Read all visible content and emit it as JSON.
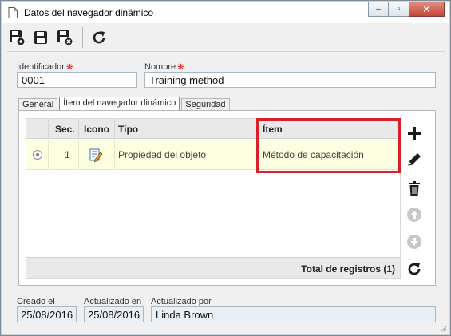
{
  "window": {
    "title": "Datos del navegador dinámico",
    "min_label": "–",
    "max_label": "▫",
    "close_label": "✕"
  },
  "toolbar": {
    "icons": [
      "save-new-icon",
      "save-icon",
      "save-close-icon",
      "refresh-icon"
    ]
  },
  "form": {
    "identifier_label": "Identificador",
    "identifier_value": "0001",
    "name_label": "Nombre",
    "name_value": "Training method",
    "required_mark": "❋"
  },
  "tabs": [
    {
      "label": "General",
      "active": false
    },
    {
      "label": "Ítem del navegador dinámico",
      "active": true
    },
    {
      "label": "Seguridad",
      "active": false
    }
  ],
  "grid": {
    "columns": {
      "seq": "Sec.",
      "icon": "Icono",
      "type": "Tipo",
      "item": "Ítem"
    },
    "rows": [
      {
        "selected": true,
        "seq": "1",
        "icon": "edit-document-icon",
        "type": "Propiedad del objeto",
        "item": "Método de capacitación"
      }
    ],
    "footer": "Total de registros (1)"
  },
  "side_actions": {
    "icons": [
      "add-icon",
      "edit-icon",
      "delete-icon",
      "move-up-icon",
      "move-down-icon",
      "refresh-icon"
    ]
  },
  "audit": {
    "created_label": "Creado el",
    "created_value": "25/08/2016",
    "updated_label": "Actualizado en",
    "updated_value": "25/08/2016",
    "updated_by_label": "Actualizado por",
    "updated_by_value": "Linda Brown"
  },
  "colors": {
    "highlight": "#d8202a",
    "selected_row": "#fdfde0",
    "active_tab_border": "#5aa35e"
  }
}
